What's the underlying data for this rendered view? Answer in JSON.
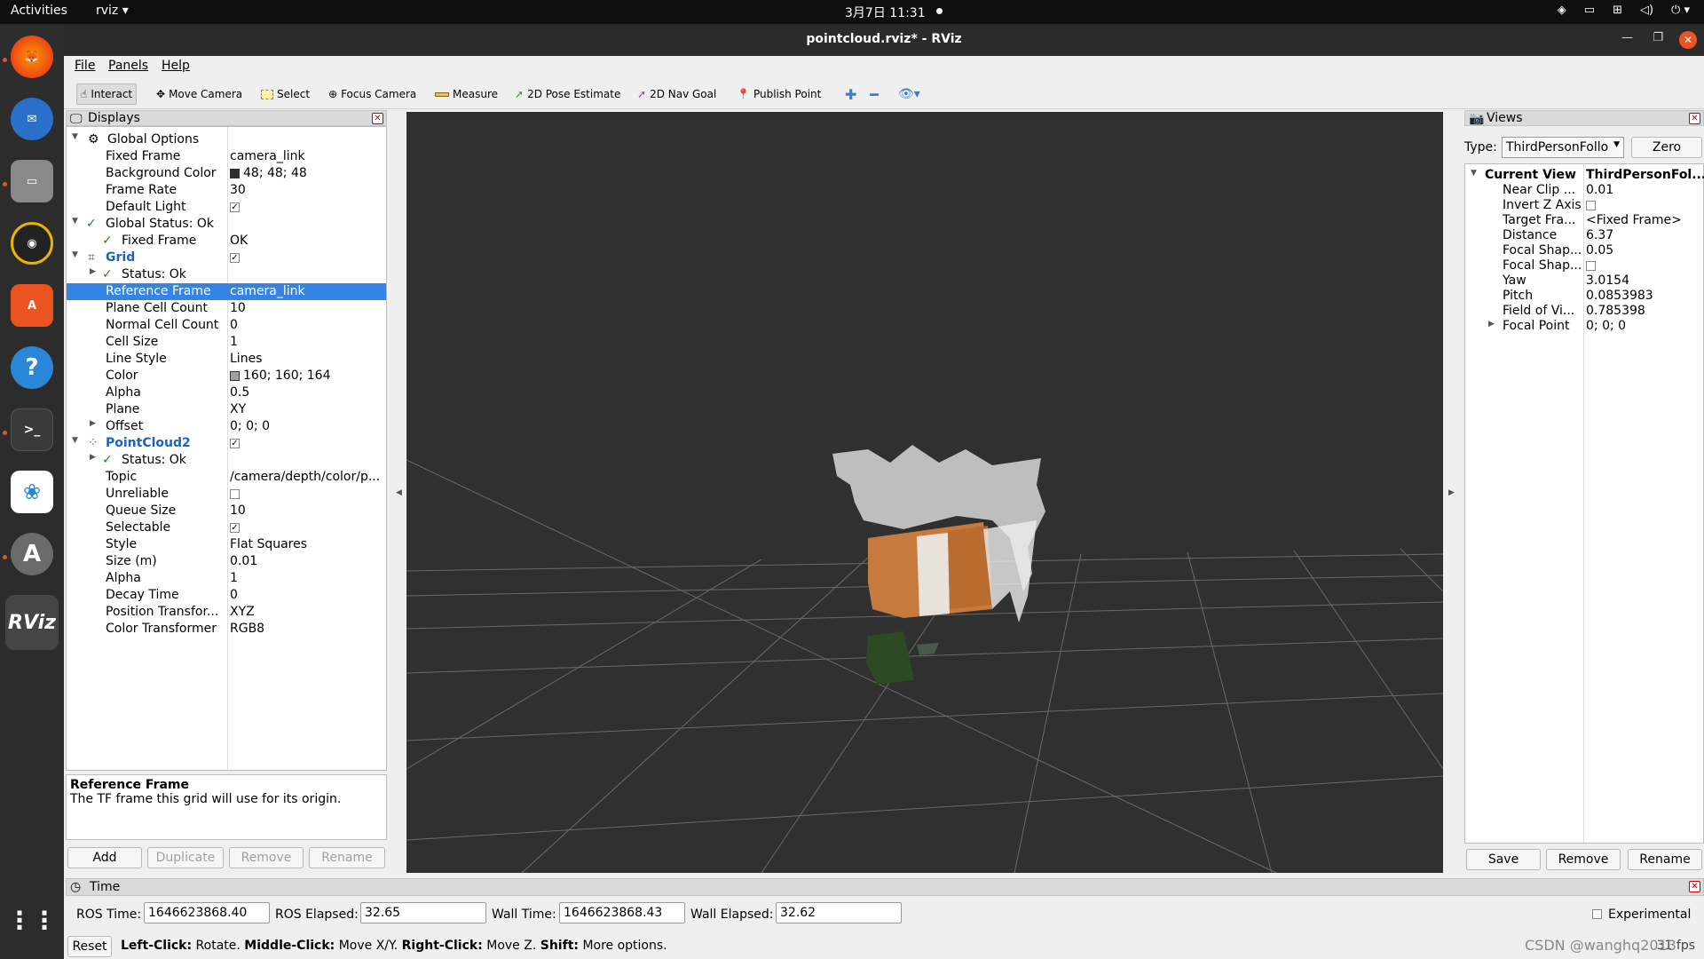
{
  "topbar": {
    "activities": "Activities",
    "app": "rviz ▾",
    "clock": "3月7日  11:31"
  },
  "window": {
    "title": "pointcloud.rviz* - RViz"
  },
  "menu": {
    "file": "File",
    "panels": "Panels",
    "help": "Help"
  },
  "toolbar": {
    "interact": "Interact",
    "move_camera": "Move Camera",
    "select": "Select",
    "focus_camera": "Focus Camera",
    "measure": "Measure",
    "pose_estimate": "2D Pose Estimate",
    "nav_goal": "2D Nav Goal",
    "publish_point": "Publish Point"
  },
  "displays": {
    "title": "Displays",
    "rows": [
      {
        "k": "Global Options"
      },
      {
        "k": "Fixed Frame",
        "v": "camera_link"
      },
      {
        "k": "Background Color",
        "v": "48; 48; 48",
        "color": "#303030"
      },
      {
        "k": "Frame Rate",
        "v": "30"
      },
      {
        "k": "Default Light",
        "v": "✓"
      },
      {
        "k": "Global Status: Ok"
      },
      {
        "k": "Fixed Frame",
        "v": "OK"
      },
      {
        "k": "Grid",
        "v": "✓"
      },
      {
        "k": "Status: Ok"
      },
      {
        "k": "Reference Frame",
        "v": "camera_link"
      },
      {
        "k": "Plane Cell Count",
        "v": "10"
      },
      {
        "k": "Normal Cell Count",
        "v": "0"
      },
      {
        "k": "Cell Size",
        "v": "1"
      },
      {
        "k": "Line Style",
        "v": "Lines"
      },
      {
        "k": "Color",
        "v": "160; 160; 164",
        "color": "#a0a0a4"
      },
      {
        "k": "Alpha",
        "v": "0.5"
      },
      {
        "k": "Plane",
        "v": "XY"
      },
      {
        "k": "Offset",
        "v": "0; 0; 0"
      },
      {
        "k": "PointCloud2",
        "v": "✓"
      },
      {
        "k": "Status: Ok"
      },
      {
        "k": "Topic",
        "v": "/camera/depth/color/p..."
      },
      {
        "k": "Unreliable",
        "v": ""
      },
      {
        "k": "Queue Size",
        "v": "10"
      },
      {
        "k": "Selectable",
        "v": "✓"
      },
      {
        "k": "Style",
        "v": "Flat Squares"
      },
      {
        "k": "Size (m)",
        "v": "0.01"
      },
      {
        "k": "Alpha",
        "v": "1"
      },
      {
        "k": "Decay Time",
        "v": "0"
      },
      {
        "k": "Position Transfor...",
        "v": "XYZ"
      },
      {
        "k": "Color Transformer",
        "v": "RGB8"
      }
    ],
    "desc_title": "Reference Frame",
    "desc_text": "The TF frame this grid will use for its origin.",
    "buttons": {
      "add": "Add",
      "duplicate": "Duplicate",
      "remove": "Remove",
      "rename": "Rename"
    }
  },
  "views": {
    "title": "Views",
    "type_label": "Type:",
    "type_value": "ThirdPersonFollo",
    "zero": "Zero",
    "current_view": "Current View",
    "current_view_value": "ThirdPersonFol...",
    "rows": [
      {
        "k": "Near Clip ...",
        "v": "0.01"
      },
      {
        "k": "Invert Z Axis",
        "v": ""
      },
      {
        "k": "Target Fra...",
        "v": "<Fixed Frame>"
      },
      {
        "k": "Distance",
        "v": "6.37"
      },
      {
        "k": "Focal Shap...",
        "v": "0.05"
      },
      {
        "k": "Focal Shap...",
        "v": ""
      },
      {
        "k": "Yaw",
        "v": "3.0154"
      },
      {
        "k": "Pitch",
        "v": "0.0853983"
      },
      {
        "k": "Field of Vi...",
        "v": "0.785398"
      },
      {
        "k": "Focal Point",
        "v": "0; 0; 0"
      }
    ],
    "buttons": {
      "save": "Save",
      "remove": "Remove",
      "rename": "Rename"
    }
  },
  "time": {
    "title": "Time",
    "ros_time_label": "ROS Time:",
    "ros_time": "1646623868.40",
    "ros_elapsed_label": "ROS Elapsed:",
    "ros_elapsed": "32.65",
    "wall_time_label": "Wall Time:",
    "wall_time": "1646623868.43",
    "wall_elapsed_label": "Wall Elapsed:",
    "wall_elapsed": "32.62",
    "experimental": "Experimental"
  },
  "status": {
    "reset": "Reset",
    "left_click": "Left-Click:",
    "left_desc": "Rotate.",
    "middle_click": "Middle-Click:",
    "middle_desc": "Move X/Y.",
    "right_click": "Right-Click:",
    "right_desc": "Move Z.",
    "shift": "Shift:",
    "shift_desc": "More options.",
    "fps": "31 fps",
    "watermark": "CSDN @wanghq2013"
  },
  "colors": {
    "accent": "#3584e4",
    "viewport": "#303030",
    "ubuntu_orange": "#e95420"
  }
}
